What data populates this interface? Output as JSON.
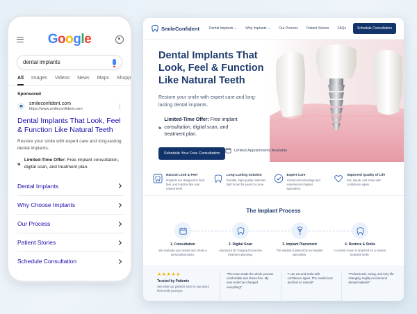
{
  "phone": {
    "logo": [
      "G",
      "o",
      "o",
      "g",
      "l",
      "e"
    ],
    "search_query": "dental implants",
    "tabs": [
      {
        "label": "All"
      },
      {
        "label": "Images"
      },
      {
        "label": "Videos"
      },
      {
        "label": "News"
      },
      {
        "label": "Maps"
      },
      {
        "label": "Shopping"
      }
    ],
    "sponsored": "Sponsored",
    "ad": {
      "site_name": "smileconfident.com",
      "site_url": "https://www.smileconfident.com",
      "title": "Dental Implants That Look, Feel & Function Like Natural Teeth",
      "description": "Restore your smile with expert care and long-lasting dental implants.",
      "offer_bold": "Limited-Time Offer:",
      "offer_text": " Free implant consultation, digital scan, and treatment plan."
    },
    "sitelinks": [
      {
        "label": "Dental Implants"
      },
      {
        "label": "Why Choose Implants"
      },
      {
        "label": "Our Process"
      },
      {
        "label": "Patient Stories"
      },
      {
        "label": "Schedule Consultation"
      }
    ]
  },
  "site": {
    "logo": "SmileConfident",
    "nav": [
      {
        "label": "Dental Implants ⌄"
      },
      {
        "label": "Why Implants ⌄"
      },
      {
        "label": "Our Process"
      },
      {
        "label": "Patient Stories"
      },
      {
        "label": "FAQs"
      }
    ],
    "nav_cta": "Schedule Consultation",
    "hero": {
      "title": "Dental Implants That Look, Feel & Function Like Natural Teeth",
      "subtitle": "Restore your smile with expert care and long-lasting dental implants.",
      "offer_bold": "Limited-Time Offer:",
      "offer_text": " Free implant consultation, digital scan, and treatment plan.",
      "cta": "Schedule Your Free Consultation",
      "limited": "Limited Appointments Available"
    },
    "features": [
      {
        "icon": "tooth-badge-icon",
        "title": "Natural Look & Feel",
        "desc": "Implants are designed to look, feel, and function like your natural teeth."
      },
      {
        "icon": "tooth-icon",
        "title": "Long-Lasting Solution",
        "desc": "Durable, high-quality materials built to last for years to come."
      },
      {
        "icon": "check-circle-icon",
        "title": "Expert Care",
        "desc": "Advanced technology and experienced implant specialists."
      },
      {
        "icon": "heart-icon",
        "title": "Improved Quality of Life",
        "desc": "Eat, speak, and smile with confidence again."
      }
    ],
    "process": {
      "title": "The Implant Process",
      "steps": [
        {
          "title": "1. Consultation",
          "desc": "We evaluate your needs and create a personalized plan."
        },
        {
          "title": "2. Digital Scan",
          "desc": "Advanced 3D imaging for precise treatment planning."
        },
        {
          "title": "3. Implant Placement",
          "desc": "The implant is placed by our implant specialists."
        },
        {
          "title": "4. Restore & Smile",
          "desc": "A custom crown is attached for a natural, beautiful smile."
        }
      ]
    },
    "testimonials": {
      "stars": "★★★★★",
      "title": "Trusted by Patients",
      "desc": "See what our patients have to say about their smile journeys.",
      "quotes": [
        "\"The team made the whole process comfortable and stress-free. My new smile has changed everything!\"",
        "\"I can eat and smile with confidence again. The results look and feel so natural!\"",
        "\"Professional, caring, and truly life-changing. Highly recommend dental implants!\""
      ]
    }
  },
  "colors": {
    "brand_navy": "#13346b",
    "link_blue": "#1a0dab",
    "heading_navy": "#1f3b6e",
    "star_gold": "#f4b400"
  }
}
